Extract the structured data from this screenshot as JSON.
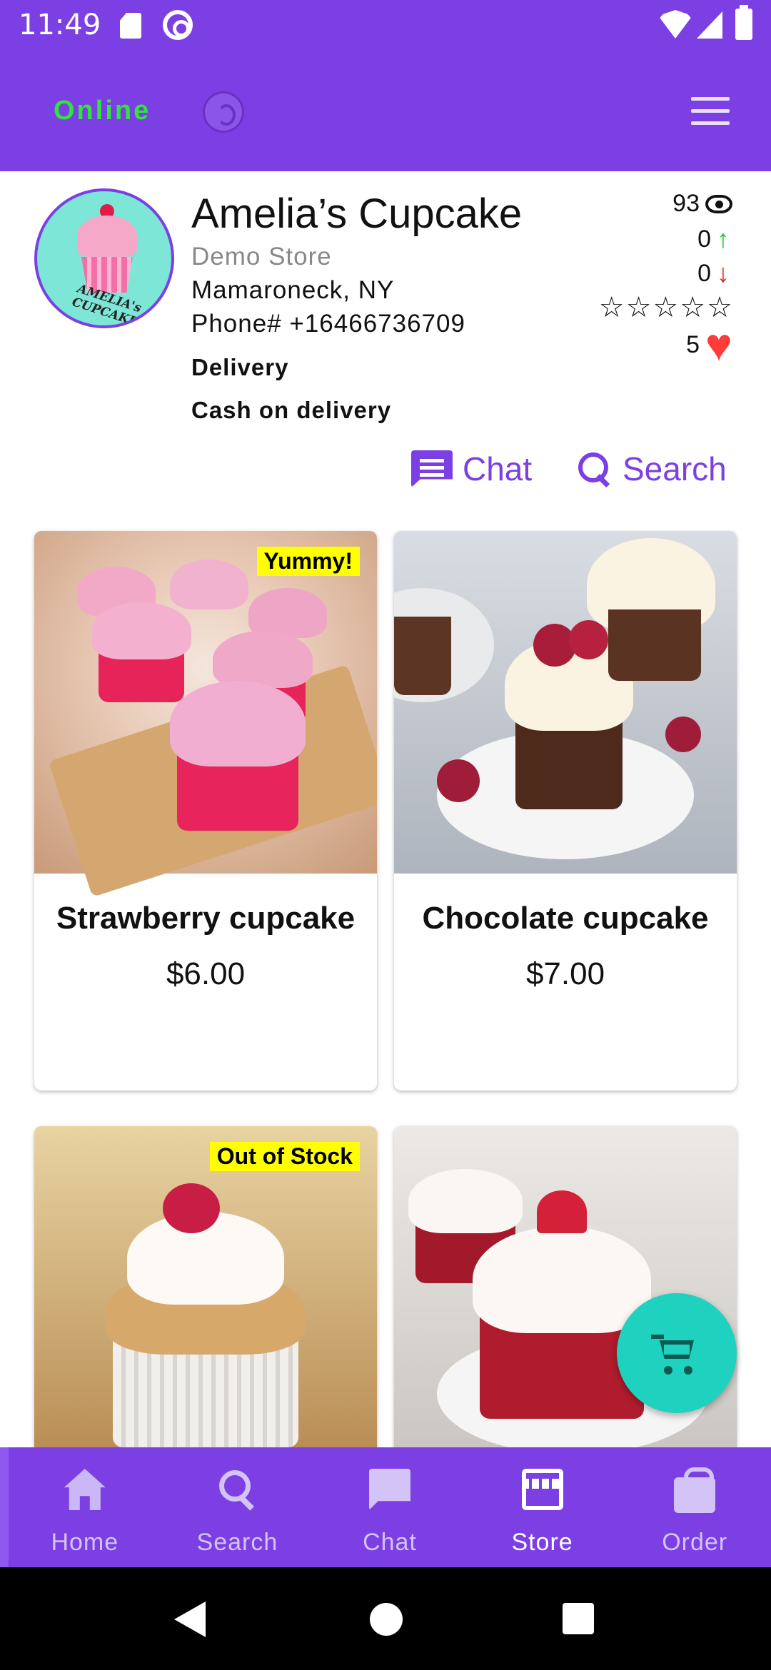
{
  "status_bar": {
    "time": "11:49"
  },
  "app_bar": {
    "status": "Online"
  },
  "store": {
    "name": "Amelia’s Cupcake",
    "subtitle": "Demo Store",
    "location": "Mamaroneck, NY",
    "phone": "Phone# +16466736709",
    "delivery": "Delivery",
    "payment": "Cash on delivery",
    "logo_text": "AMELIA's CUPCAKE",
    "stats": {
      "views": "93",
      "up": "0",
      "down": "0",
      "stars": "☆☆☆☆☆",
      "favorites": "5"
    }
  },
  "actions": {
    "chat": "Chat",
    "search": "Search"
  },
  "products": [
    {
      "name": "Strawberry cupcake",
      "price": "$6.00",
      "badge": "Yummy!"
    },
    {
      "name": "Chocolate cupcake",
      "price": "$7.00",
      "badge": ""
    },
    {
      "name": "",
      "price": "",
      "badge": "Out of Stock"
    },
    {
      "name": "",
      "price": "",
      "badge": ""
    }
  ],
  "bottom_nav": [
    {
      "label": "Home",
      "icon": "home-icon"
    },
    {
      "label": "Search",
      "icon": "search-icon"
    },
    {
      "label": "Chat",
      "icon": "chat-icon"
    },
    {
      "label": "Store",
      "icon": "store-icon",
      "active": true
    },
    {
      "label": "Order",
      "icon": "bag-icon"
    }
  ],
  "colors": {
    "primary": "#7b3fe4",
    "online": "#2ee63a",
    "fab": "#1fd2bf",
    "badge": "#ffff00",
    "heart": "#ff3b3b"
  }
}
